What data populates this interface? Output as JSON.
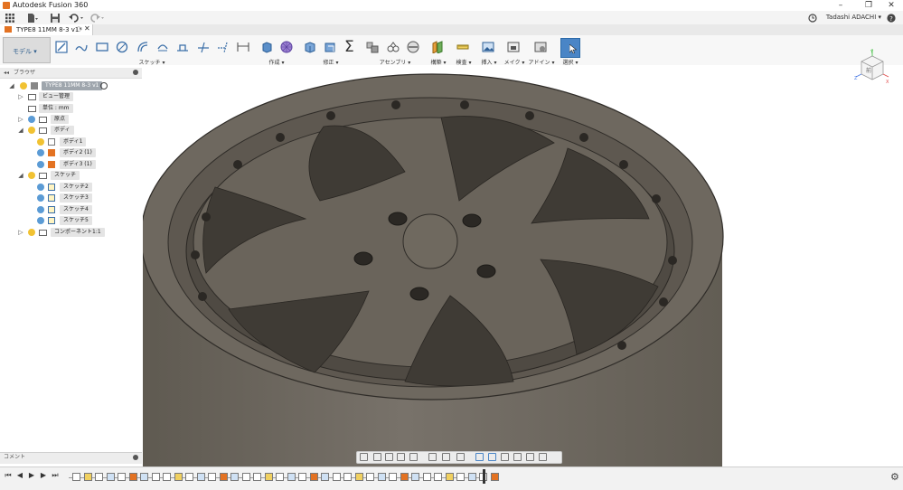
{
  "window": {
    "app_title": "Autodesk Fusion 360",
    "controls": [
      "–",
      "❐",
      "✕"
    ]
  },
  "quick_access": {
    "user_name": "Tadashi ADACHI ▾",
    "help": "?"
  },
  "document_tab": {
    "label": "TYPE8 11MM 8-3 v1*"
  },
  "toolbar": {
    "workspace_label": "モデル ▾",
    "groups": [
      {
        "label": "スケッチ ▾"
      },
      {
        "label": "作成 ▾"
      },
      {
        "label": "修正 ▾"
      },
      {
        "label": "アセンブリ ▾"
      },
      {
        "label": "構築 ▾"
      },
      {
        "label": "検査 ▾"
      },
      {
        "label": "挿入 ▾"
      },
      {
        "label": "メイク ▾"
      },
      {
        "label": "アドイン ▾"
      },
      {
        "label": "選択 ▾"
      }
    ]
  },
  "browser": {
    "title": "ブラウザ",
    "items": [
      {
        "label": "TYPE8 11MM 8-3 v1"
      },
      {
        "label": "ビュー管理"
      },
      {
        "label": "単位 : mm"
      },
      {
        "label": "原点"
      },
      {
        "label": "ボディ"
      },
      {
        "label": "ボディ1"
      },
      {
        "label": "ボディ2 (1)"
      },
      {
        "label": "ボディ3 (1)"
      },
      {
        "label": "スケッチ"
      },
      {
        "label": "スケッチ2"
      },
      {
        "label": "スケッチ3"
      },
      {
        "label": "スケッチ4"
      },
      {
        "label": "スケッチ5"
      },
      {
        "label": "コンポーネント1:1"
      }
    ]
  },
  "comments": {
    "label": "コメント"
  },
  "viewcube": {
    "face_label": "前",
    "axis_x": "X",
    "axis_y": "Y",
    "axis_z": "Z"
  },
  "colors": {
    "model_body": "#6b655b",
    "model_dark": "#4a453e",
    "select_accent": "#4a85c6",
    "bulb_yellow": "#f1c232",
    "bulb_blue": "#5b9bd5"
  }
}
